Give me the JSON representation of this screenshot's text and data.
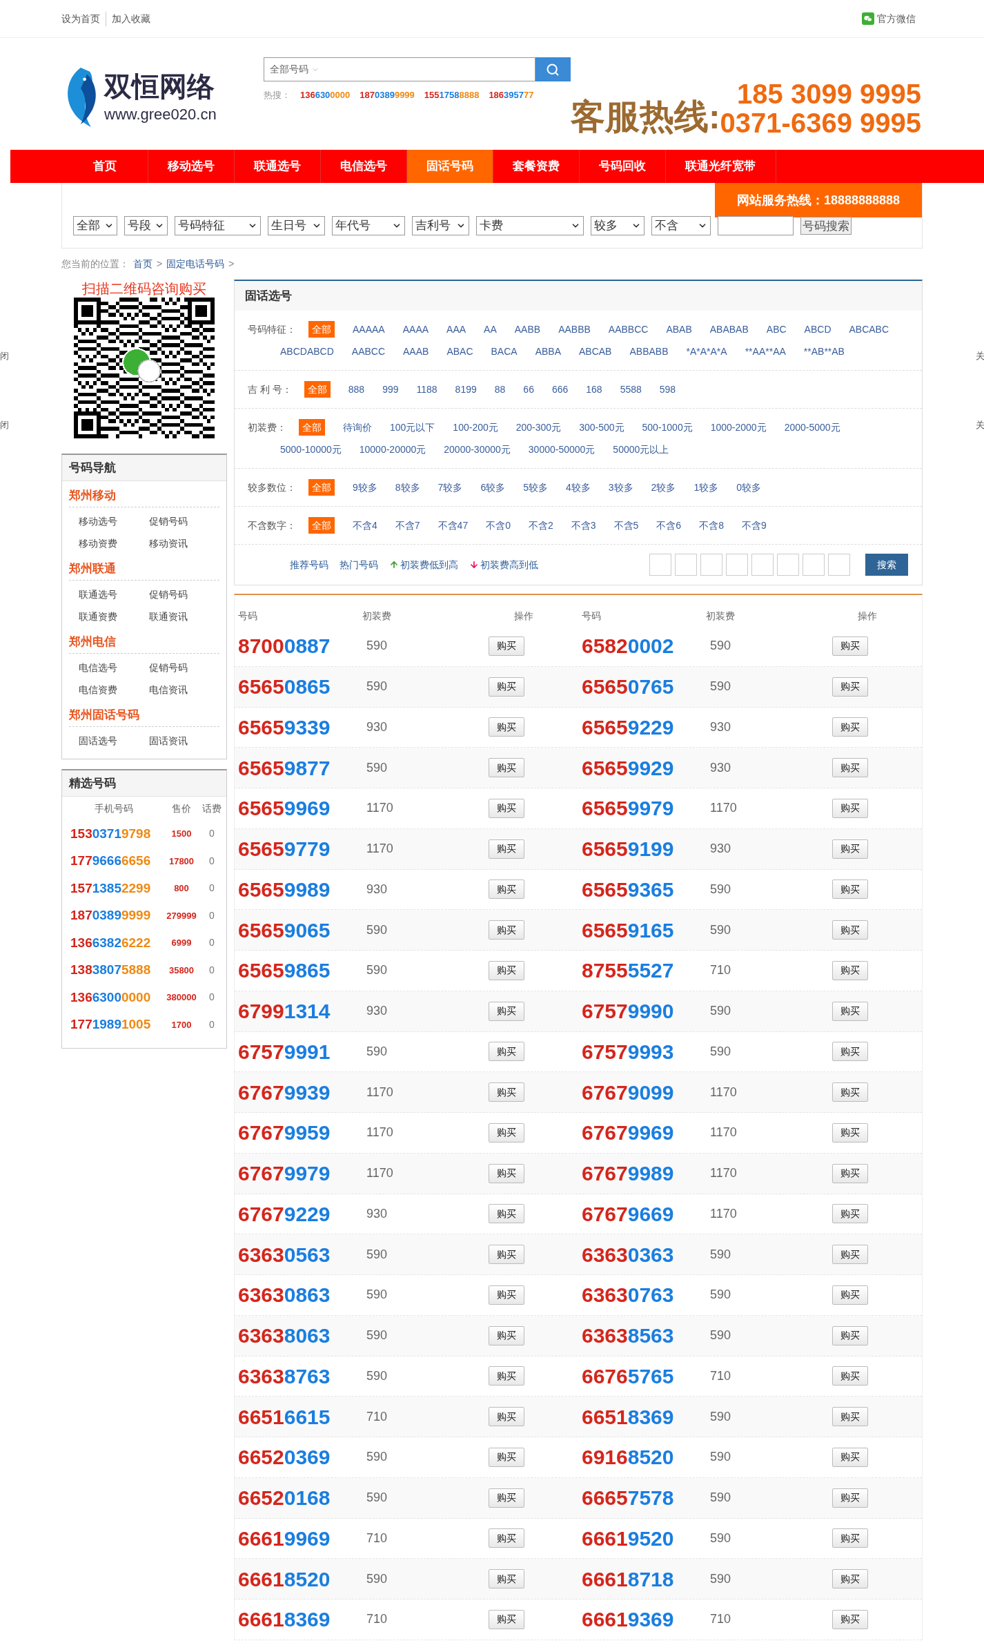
{
  "top_bar": {
    "links": [
      "设为首页",
      "加入收藏"
    ],
    "wechat": "官方微信"
  },
  "header": {
    "logo_name": "双恒网络",
    "logo_url": "www.gree020.cn",
    "search": {
      "category": "全部号码"
    },
    "hot_label": "热搜：",
    "hot_numbers": [
      {
        "parts": [
          "136",
          "630",
          "0000"
        ]
      },
      {
        "parts": [
          "187",
          "0389",
          "9999"
        ]
      },
      {
        "parts": [
          "155",
          "1758",
          "8888"
        ]
      },
      {
        "parts": [
          "186",
          "3957",
          "77"
        ]
      }
    ],
    "hotline_label": "客服热线:",
    "hotline_numbers": [
      "185 3099 9995",
      "0371-6369 9995"
    ]
  },
  "nav": [
    {
      "label": "首页",
      "selected": false
    },
    {
      "label": "移动选号",
      "selected": false
    },
    {
      "label": "联通选号",
      "selected": false
    },
    {
      "label": "电信选号",
      "selected": false
    },
    {
      "label": "固话号码",
      "selected": true
    },
    {
      "label": "套餐资费",
      "selected": false
    },
    {
      "label": "号码回收",
      "selected": false
    },
    {
      "label": "联通光纤宽带",
      "selected": false
    }
  ],
  "filter_bar": {
    "hotline": "网站服务热线：18888888888",
    "selects": [
      "全部",
      "号段",
      "号码特征",
      "生日号",
      "年代号",
      "吉利号",
      "卡费",
      "较多",
      "不含"
    ],
    "button": "号码搜索"
  },
  "breadcrumb": {
    "label": "您当前的位置：",
    "separator": ">",
    "items": [
      "首页",
      "固定电话号码"
    ]
  },
  "edge_tabs": {
    "left": [
      "闭",
      "闭"
    ],
    "right": [
      "关",
      "关"
    ]
  },
  "sidebar": {
    "qr_title": "扫描二维码咨询购买",
    "nav": {
      "title": "号码导航",
      "groups": [
        {
          "title": "郑州移动",
          "links": [
            "移动选号",
            "促销号码",
            "移动资费",
            "移动资讯"
          ]
        },
        {
          "title": "郑州联通",
          "links": [
            "联通选号",
            "促销号码",
            "联通资费",
            "联通资讯"
          ]
        },
        {
          "title": "郑州电信",
          "links": [
            "电信选号",
            "促销号码",
            "电信资费",
            "电信资讯"
          ]
        },
        {
          "title": "郑州固话号码",
          "links": [
            "固话选号",
            "固话资讯"
          ]
        }
      ]
    },
    "picks": {
      "title": "精选号码",
      "columns": [
        "手机号码",
        "售价",
        "话费"
      ],
      "rows": [
        {
          "parts": [
            "153",
            "0371",
            "9798"
          ],
          "price": "1500",
          "fee": "0"
        },
        {
          "parts": [
            "177",
            "9666",
            "6656"
          ],
          "price": "17800",
          "fee": "0"
        },
        {
          "parts": [
            "157",
            "1385",
            "2299"
          ],
          "price": "800",
          "fee": "0"
        },
        {
          "parts": [
            "187",
            "0389",
            "9999"
          ],
          "price": "279999",
          "fee": "0"
        },
        {
          "parts": [
            "136",
            "6382",
            "6222"
          ],
          "price": "6999",
          "fee": "0"
        },
        {
          "parts": [
            "138",
            "3807",
            "5888"
          ],
          "price": "35800",
          "fee": "0"
        },
        {
          "parts": [
            "136",
            "6300",
            "0000"
          ],
          "price": "380000",
          "fee": "0"
        },
        {
          "parts": [
            "177",
            "1989",
            "1005"
          ],
          "price": "1700",
          "fee": "0"
        }
      ]
    }
  },
  "filter_panel": {
    "title": "固话选号",
    "rows": [
      {
        "label": "号码特征：",
        "options": [
          {
            "label": "全部",
            "selected": true
          },
          {
            "label": "AAAAA",
            "selected": false
          },
          {
            "label": "AAAA",
            "selected": false
          },
          {
            "label": "AAA",
            "selected": false
          },
          {
            "label": "AA",
            "selected": false
          },
          {
            "label": "AABB",
            "selected": false
          },
          {
            "label": "AABBB",
            "selected": false
          },
          {
            "label": "AABBCC",
            "selected": false
          },
          {
            "label": "ABAB",
            "selected": false
          },
          {
            "label": "ABABAB",
            "selected": false
          },
          {
            "label": "ABC",
            "selected": false
          },
          {
            "label": "ABCD",
            "selected": false
          },
          {
            "label": "ABCABC",
            "selected": false
          },
          {
            "label": "ABCDABCD",
            "selected": false
          },
          {
            "label": "AABCC",
            "selected": false
          },
          {
            "label": "AAAB",
            "selected": false
          },
          {
            "label": "ABAC",
            "selected": false
          },
          {
            "label": "BACA",
            "selected": false
          },
          {
            "label": "ABBA",
            "selected": false
          },
          {
            "label": "ABCAB",
            "selected": false
          },
          {
            "label": "ABBABB",
            "selected": false
          },
          {
            "label": "*A*A*A*A",
            "selected": false
          },
          {
            "label": "**AA**AA",
            "selected": false
          },
          {
            "label": "**AB**AB",
            "selected": false
          }
        ]
      },
      {
        "label": "吉 利 号：",
        "options": [
          {
            "label": "全部",
            "selected": true
          },
          {
            "label": "888",
            "selected": false
          },
          {
            "label": "999",
            "selected": false
          },
          {
            "label": "1188",
            "selected": false
          },
          {
            "label": "8199",
            "selected": false
          },
          {
            "label": "88",
            "selected": false
          },
          {
            "label": "66",
            "selected": false
          },
          {
            "label": "666",
            "selected": false
          },
          {
            "label": "168",
            "selected": false
          },
          {
            "label": "5588",
            "selected": false
          },
          {
            "label": "598",
            "selected": false
          }
        ]
      },
      {
        "label": "初装费：",
        "options": [
          {
            "label": "全部",
            "selected": true
          },
          {
            "label": "待询价",
            "selected": false
          },
          {
            "label": "100元以下",
            "selected": false
          },
          {
            "label": "100-200元",
            "selected": false
          },
          {
            "label": "200-300元",
            "selected": false
          },
          {
            "label": "300-500元",
            "selected": false
          },
          {
            "label": "500-1000元",
            "selected": false
          },
          {
            "label": "1000-2000元",
            "selected": false
          },
          {
            "label": "2000-5000元",
            "selected": false
          },
          {
            "label": "5000-10000元",
            "selected": false
          },
          {
            "label": "10000-20000元",
            "selected": false
          },
          {
            "label": "20000-30000元",
            "selected": false
          },
          {
            "label": "30000-50000元",
            "selected": false
          },
          {
            "label": "50000元以上",
            "selected": false
          }
        ]
      },
      {
        "label": "较多数位：",
        "options": [
          {
            "label": "全部",
            "selected": true
          },
          {
            "label": "9较多",
            "selected": false
          },
          {
            "label": "8较多",
            "selected": false
          },
          {
            "label": "7较多",
            "selected": false
          },
          {
            "label": "6较多",
            "selected": false
          },
          {
            "label": "5较多",
            "selected": false
          },
          {
            "label": "4较多",
            "selected": false
          },
          {
            "label": "3较多",
            "selected": false
          },
          {
            "label": "2较多",
            "selected": false
          },
          {
            "label": "1较多",
            "selected": false
          },
          {
            "label": "0较多",
            "selected": false
          }
        ]
      },
      {
        "label": "不含数字：",
        "options": [
          {
            "label": "全部",
            "selected": true
          },
          {
            "label": "不含4",
            "selected": false
          },
          {
            "label": "不含7",
            "selected": false
          },
          {
            "label": "不含47",
            "selected": false
          },
          {
            "label": "不含0",
            "selected": false
          },
          {
            "label": "不含2",
            "selected": false
          },
          {
            "label": "不含3",
            "selected": false
          },
          {
            "label": "不含5",
            "selected": false
          },
          {
            "label": "不含6",
            "selected": false
          },
          {
            "label": "不含8",
            "selected": false
          },
          {
            "label": "不含9",
            "selected": false
          }
        ]
      }
    ],
    "sort_links": [
      {
        "label": "推荐号码",
        "kind": "plain"
      },
      {
        "label": "热门号码",
        "kind": "plain"
      },
      {
        "label": "初装费低到高",
        "kind": "ascending"
      },
      {
        "label": "初装费高到低",
        "kind": "descending"
      }
    ],
    "button": "搜索"
  },
  "table": {
    "columns": [
      "号码",
      "初装费",
      "操作",
      "号码",
      "初装费",
      "操作"
    ],
    "cells": [
      {
        "parts": [
          "8700",
          "0887"
        ],
        "fee": "590",
        "action": "购买"
      },
      {
        "parts": [
          "6582",
          "0002"
        ],
        "fee": "590",
        "action": "购买"
      },
      {
        "parts": [
          "6565",
          "0865"
        ],
        "fee": "590",
        "action": "购买"
      },
      {
        "parts": [
          "6565",
          "0765"
        ],
        "fee": "590",
        "action": "购买"
      },
      {
        "parts": [
          "6565",
          "9339"
        ],
        "fee": "930",
        "action": "购买"
      },
      {
        "parts": [
          "6565",
          "9229"
        ],
        "fee": "930",
        "action": "购买"
      },
      {
        "parts": [
          "6565",
          "9877"
        ],
        "fee": "590",
        "action": "购买"
      },
      {
        "parts": [
          "6565",
          "9929"
        ],
        "fee": "930",
        "action": "购买"
      },
      {
        "parts": [
          "6565",
          "9969"
        ],
        "fee": "1170",
        "action": "购买"
      },
      {
        "parts": [
          "6565",
          "9979"
        ],
        "fee": "1170",
        "action": "购买"
      },
      {
        "parts": [
          "6565",
          "9779"
        ],
        "fee": "1170",
        "action": "购买"
      },
      {
        "parts": [
          "6565",
          "9199"
        ],
        "fee": "930",
        "action": "购买"
      },
      {
        "parts": [
          "6565",
          "9989"
        ],
        "fee": "930",
        "action": "购买"
      },
      {
        "parts": [
          "6565",
          "9365"
        ],
        "fee": "590",
        "action": "购买"
      },
      {
        "parts": [
          "6565",
          "9065"
        ],
        "fee": "590",
        "action": "购买"
      },
      {
        "parts": [
          "6565",
          "9165"
        ],
        "fee": "590",
        "action": "购买"
      },
      {
        "parts": [
          "6565",
          "9865"
        ],
        "fee": "590",
        "action": "购买"
      },
      {
        "parts": [
          "8755",
          "5527"
        ],
        "fee": "710",
        "action": "购买"
      },
      {
        "parts": [
          "6799",
          "1314"
        ],
        "fee": "930",
        "action": "购买"
      },
      {
        "parts": [
          "6757",
          "9990"
        ],
        "fee": "590",
        "action": "购买"
      },
      {
        "parts": [
          "6757",
          "9991"
        ],
        "fee": "590",
        "action": "购买"
      },
      {
        "parts": [
          "6757",
          "9993"
        ],
        "fee": "590",
        "action": "购买"
      },
      {
        "parts": [
          "6767",
          "9939"
        ],
        "fee": "1170",
        "action": "购买"
      },
      {
        "parts": [
          "6767",
          "9099"
        ],
        "fee": "1170",
        "action": "购买"
      },
      {
        "parts": [
          "6767",
          "9959"
        ],
        "fee": "1170",
        "action": "购买"
      },
      {
        "parts": [
          "6767",
          "9969"
        ],
        "fee": "1170",
        "action": "购买"
      },
      {
        "parts": [
          "6767",
          "9979"
        ],
        "fee": "1170",
        "action": "购买"
      },
      {
        "parts": [
          "6767",
          "9989"
        ],
        "fee": "1170",
        "action": "购买"
      },
      {
        "parts": [
          "6767",
          "9229"
        ],
        "fee": "930",
        "action": "购买"
      },
      {
        "parts": [
          "6767",
          "9669"
        ],
        "fee": "1170",
        "action": "购买"
      },
      {
        "parts": [
          "6363",
          "0563"
        ],
        "fee": "590",
        "action": "购买"
      },
      {
        "parts": [
          "6363",
          "0363"
        ],
        "fee": "590",
        "action": "购买"
      },
      {
        "parts": [
          "6363",
          "0863"
        ],
        "fee": "590",
        "action": "购买"
      },
      {
        "parts": [
          "6363",
          "0763"
        ],
        "fee": "590",
        "action": "购买"
      },
      {
        "parts": [
          "6363",
          "8063"
        ],
        "fee": "590",
        "action": "购买"
      },
      {
        "parts": [
          "6363",
          "8563"
        ],
        "fee": "590",
        "action": "购买"
      },
      {
        "parts": [
          "6363",
          "8763"
        ],
        "fee": "590",
        "action": "购买"
      },
      {
        "parts": [
          "6676",
          "5765"
        ],
        "fee": "710",
        "action": "购买"
      },
      {
        "parts": [
          "6651",
          "6615"
        ],
        "fee": "710",
        "action": "购买"
      },
      {
        "parts": [
          "6651",
          "8369"
        ],
        "fee": "590",
        "action": "购买"
      },
      {
        "parts": [
          "6652",
          "0369"
        ],
        "fee": "590",
        "action": "购买"
      },
      {
        "parts": [
          "6916",
          "8520"
        ],
        "fee": "590",
        "action": "购买"
      },
      {
        "parts": [
          "6652",
          "0168"
        ],
        "fee": "590",
        "action": "购买"
      },
      {
        "parts": [
          "6665",
          "7578"
        ],
        "fee": "590",
        "action": "购买"
      },
      {
        "parts": [
          "6661",
          "9969"
        ],
        "fee": "710",
        "action": "购买"
      },
      {
        "parts": [
          "6661",
          "9520"
        ],
        "fee": "590",
        "action": "购买"
      },
      {
        "parts": [
          "6661",
          "8520"
        ],
        "fee": "590",
        "action": "购买"
      },
      {
        "parts": [
          "6661",
          "8718"
        ],
        "fee": "590",
        "action": "购买"
      },
      {
        "parts": [
          "6661",
          "8369"
        ],
        "fee": "710",
        "action": "购买"
      },
      {
        "parts": [
          "6661",
          "9369"
        ],
        "fee": "710",
        "action": "购买"
      }
    ]
  }
}
